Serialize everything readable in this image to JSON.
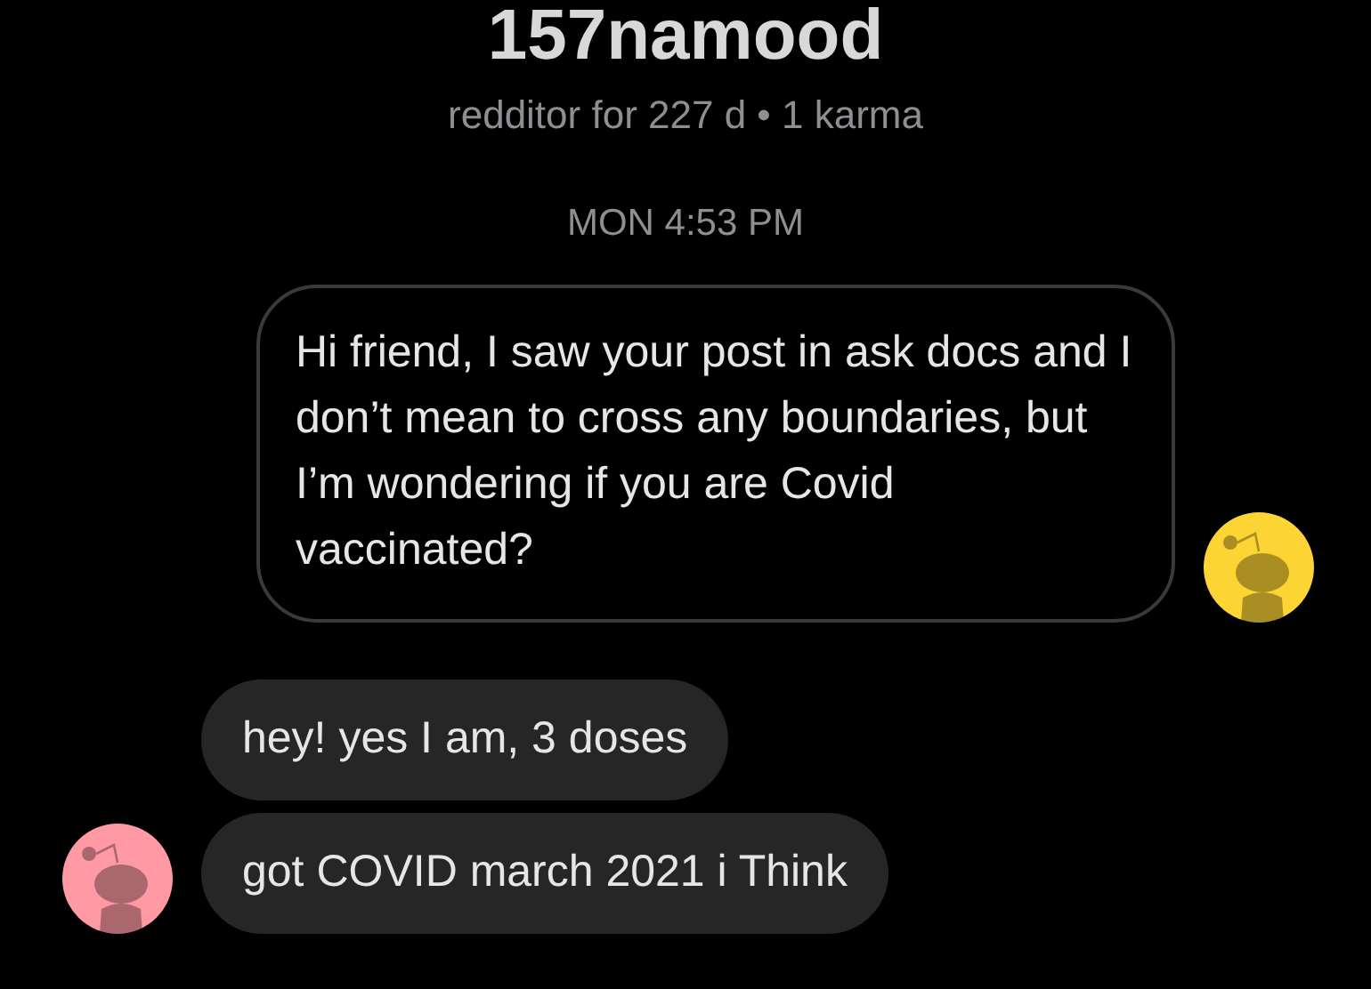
{
  "header": {
    "username": "157namood",
    "subtitle": "redditor for 227 d • 1 karma"
  },
  "timestamp": "MON 4:53 PM",
  "messages": [
    {
      "kind": "outgoing",
      "text": "Hi friend, I saw your post in ask docs and I don’t mean to cross any boundaries, but I’m wondering if you are Covid vaccinated?",
      "avatar": {
        "color": "#fcd535"
      }
    },
    {
      "kind": "incoming",
      "text": "hey! yes I am, 3 doses"
    },
    {
      "kind": "incoming",
      "text": "got COVID march 2021 i Think",
      "avatar": {
        "color": "#ff9aa5"
      }
    }
  ]
}
